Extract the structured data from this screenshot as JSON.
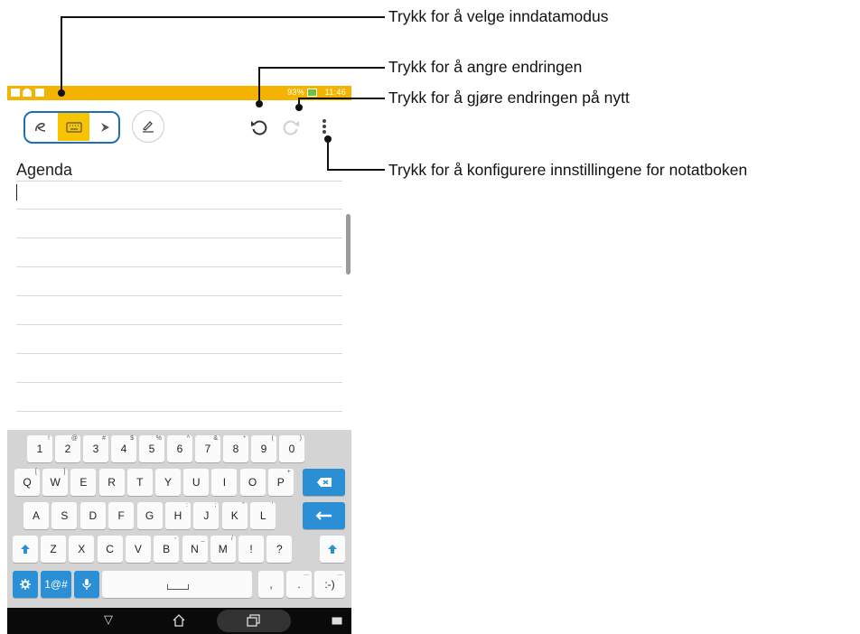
{
  "callouts": {
    "input_mode": "Trykk for å velge inndatamodus",
    "undo": "Trykk for å angre endringen",
    "redo": "Trykk for å gjøre endringen på nytt",
    "settings": "Trykk for å konfigurere innstillingene for notatboken"
  },
  "status_bar": {
    "battery_percent": "93%",
    "time": "11:46"
  },
  "toolbar": {
    "input_modes": [
      "handwriting",
      "keyboard",
      "pen"
    ],
    "active_mode": "keyboard"
  },
  "note": {
    "title": "Agenda"
  },
  "keyboard": {
    "row1": [
      [
        "1",
        "!"
      ],
      [
        "2",
        "@"
      ],
      [
        "3",
        "#"
      ],
      [
        "4",
        "$"
      ],
      [
        "5",
        "%"
      ],
      [
        "6",
        "^"
      ],
      [
        "7",
        "&"
      ],
      [
        "8",
        "*"
      ],
      [
        "9",
        "("
      ],
      [
        "0",
        ")"
      ]
    ],
    "row2": [
      [
        "Q",
        "["
      ],
      [
        "W",
        "]"
      ],
      [
        "E",
        ""
      ],
      [
        "R",
        ""
      ],
      [
        "T",
        ""
      ],
      [
        "Y",
        ""
      ],
      [
        "U",
        ""
      ],
      [
        "I",
        ""
      ],
      [
        "O",
        ""
      ],
      [
        "P",
        "+"
      ]
    ],
    "row3": [
      [
        "A",
        ""
      ],
      [
        "S",
        ""
      ],
      [
        "D",
        ""
      ],
      [
        "F",
        ""
      ],
      [
        "G",
        ""
      ],
      [
        "H",
        ":"
      ],
      [
        "J",
        ";"
      ],
      [
        "K",
        "\""
      ],
      [
        "L",
        "'"
      ]
    ],
    "row4": [
      [
        "Z",
        ""
      ],
      [
        "X",
        ""
      ],
      [
        "C",
        ""
      ],
      [
        "V",
        ""
      ],
      [
        "B",
        "-"
      ],
      [
        "N",
        "_"
      ],
      [
        "M",
        "/"
      ],
      [
        "!",
        ""
      ],
      [
        "?",
        ""
      ]
    ],
    "symbols_label": "1@#",
    "comma": ",",
    "period": ".",
    "emoticon": ":-)",
    "accent": "#2a8fd5"
  },
  "colors": {
    "status_bar": "#f4b300",
    "mode_highlight": "#f8c400",
    "mode_border": "#1f6fb4"
  }
}
